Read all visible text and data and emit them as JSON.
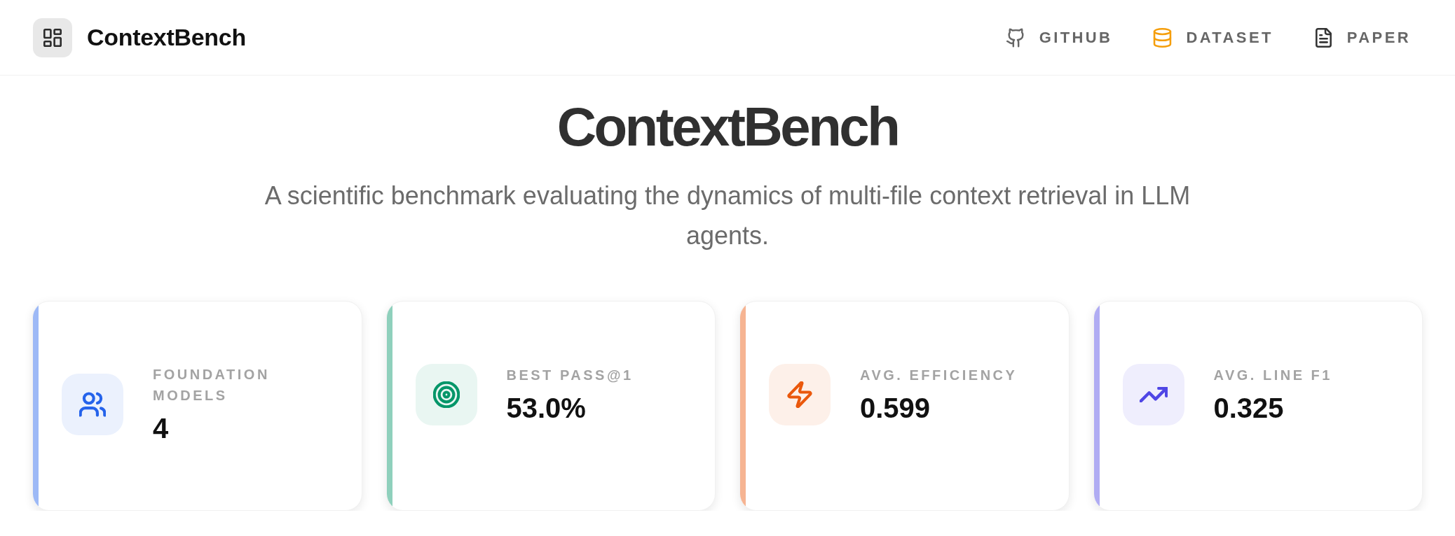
{
  "header": {
    "brand": "ContextBench",
    "nav": [
      {
        "label": "GITHUB",
        "color": "#666666"
      },
      {
        "label": "DATASET",
        "color": "#f59e0b"
      },
      {
        "label": "PAPER",
        "color": "#333333"
      }
    ]
  },
  "hero": {
    "title": "ContextBench",
    "subtitle": "A scientific benchmark evaluating the dynamics of multi-file context retrieval in LLM agents."
  },
  "stats": [
    {
      "label": "FOUNDATION MODELS",
      "value": "4",
      "color": "#2563eb"
    },
    {
      "label": "BEST PASS@1",
      "value": "53.0%",
      "color": "#059669"
    },
    {
      "label": "AVG. EFFICIENCY",
      "value": "0.599",
      "color": "#ea580c"
    },
    {
      "label": "AVG. LINE F1",
      "value": "0.325",
      "color": "#4f46e5"
    }
  ]
}
